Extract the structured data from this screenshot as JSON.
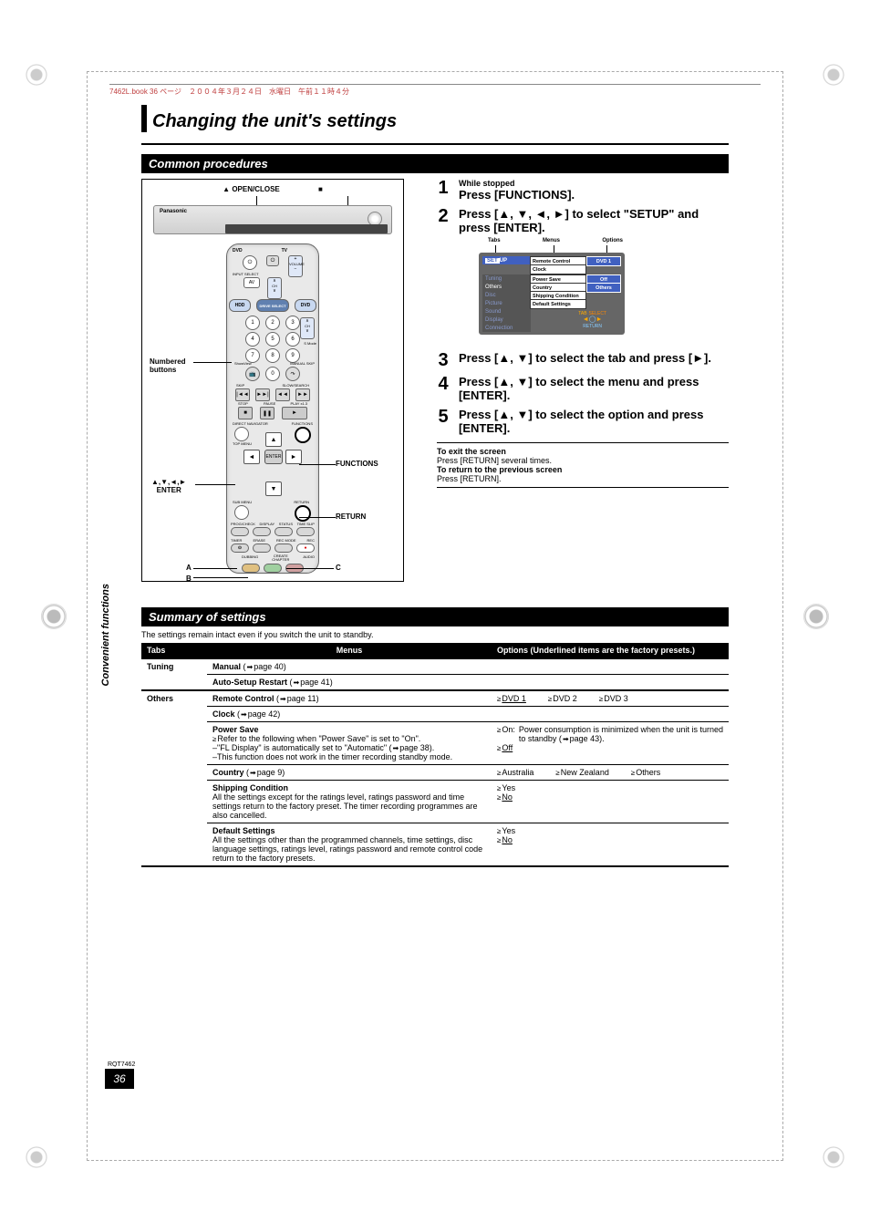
{
  "header_strip": "7462L.book  36 ページ　２００４年３月２４日　水曜日　午前１１時４分",
  "page_title": "Changing the unit's settings",
  "sections": {
    "common": "Common procedures",
    "summary": "Summary of settings"
  },
  "sidebar": "Convenient functions",
  "remote": {
    "open_close": "OPEN/CLOSE",
    "brand": "Panasonic",
    "numbered_label": "Numbered\nbuttons",
    "enter_label": "▲,▼,◄,►\nENTER",
    "functions_label": "FUNCTIONS",
    "return_label": "RETURN",
    "hdd": "HDD",
    "drive_select": "DRIVE SELECT",
    "dvd": "DVD",
    "tvlabel": "TV",
    "dvdlabel": "DVD",
    "inputsel": "INPUT SELECT",
    "av": "AV",
    "chplus": "+",
    "chminus": "−",
    "ch": "CH",
    "volplus": "+",
    "volminus": "−",
    "volume": "VOLUME",
    "nums": [
      "1",
      "2",
      "3",
      "4",
      "5",
      "6",
      "7",
      "8",
      "9",
      "0"
    ],
    "schmode": "S Mode",
    "cancel": "CANCEL",
    "manual_skip": "MANUAL SKIP",
    "showview": "ShowView",
    "skip": "SKIP",
    "slow": "SLOW/SEARCH",
    "stop": "STOP",
    "pause": "PAUSE",
    "play": "PLAY x1.3",
    "direct_nav": "DIRECT NAVIGATOR",
    "top_menu": "TOP MENU",
    "functions_btn": "FUNCTIONS",
    "enter": "ENTER",
    "submenu": "SUB MENU",
    "return_btn": "RETURN",
    "progcheck": "PROG/CHECK",
    "display": "DISPLAY",
    "status": "STATUS",
    "timeslip": "TIME SLIP",
    "timer": "TIMER",
    "erase": "ERASE",
    "recmode": "REC MODE",
    "rec": "REC",
    "dubbing": "DUBBING",
    "create_chapter": "CREATE\nCHAPTER",
    "audio": "AUDIO",
    "a_label": "A",
    "b_label": "B",
    "c_label": "C",
    "square_sym": "■",
    "triangle_sym": "▲"
  },
  "steps": {
    "s1_small": "While stopped",
    "s1_main": "Press [FUNCTIONS].",
    "s2_main": "Press [▲, ▼, ◄, ►] to select \"SETUP\" and press [ENTER].",
    "s3_main": "Press [▲, ▼] to select the tab and press [►].",
    "s4_main": "Press [▲, ▼] to select the menu and press [ENTER].",
    "s5_main": "Press [▲, ▼] to select the option and press [ENTER].",
    "n1": "1",
    "n2": "2",
    "n3": "3",
    "n4": "4",
    "n5": "5"
  },
  "setup_diagram": {
    "col_tabs": "Tabs",
    "col_menus": "Menus",
    "col_options": "Options",
    "tab_setup": "SETUP",
    "tab_tuning": "Tuning",
    "tab_others": "Others",
    "tab_disc": "Disc",
    "tab_picture": "Picture",
    "tab_sound": "Sound",
    "tab_display": "Display",
    "tab_connection": "Connection",
    "menus": [
      "Remote Control",
      "Clock",
      "Power Save",
      "Country",
      "Shipping Condition",
      "Default Settings"
    ],
    "opts": [
      "DVD 1",
      "Off",
      "Others"
    ],
    "cross_select": "SELECT",
    "cross_return": "RETURN",
    "cross_tab": "TAB"
  },
  "exit": {
    "exit_title": "To exit the screen",
    "exit_body": "Press [RETURN] several times.",
    "prev_title": "To return to the previous screen",
    "prev_body": "Press [RETURN]."
  },
  "summary": {
    "intro": "The settings remain intact even if you switch the unit to standby.",
    "hdr_tabs": "Tabs",
    "hdr_menus": "Menus",
    "hdr_options": "Options (Underlined items are the factory presets.)",
    "tuning": {
      "label": "Tuning",
      "manual": "Manual",
      "manual_ref": "page 40)",
      "auto": "Auto-Setup Restart",
      "auto_ref": "page 41)"
    },
    "others": {
      "label": "Others",
      "remote": "Remote Control",
      "remote_ref": "page 11)",
      "remote_opts": [
        "DVD 1",
        "DVD 2",
        "DVD 3"
      ],
      "clock": "Clock",
      "clock_ref": "page 42)",
      "powersave": "Power Save",
      "powersave_note1": "Refer to the following when \"Power Save\" is set to \"On\".",
      "powersave_note2": "–\"FL Display\" is automatically set to \"Automatic\" (",
      "powersave_note2b": "page 38).",
      "powersave_note3": "–This function does not work in the timer recording standby mode.",
      "powersave_on": "On:",
      "powersave_on_desc": "Power consumption is minimized when the unit is turned to standby (",
      "powersave_on_ref": "page 43).",
      "powersave_off": "Off",
      "country": "Country",
      "country_ref": "page 9)",
      "country_opts": [
        "Australia",
        "New Zealand",
        "Others"
      ],
      "shipping": "Shipping Condition",
      "shipping_desc": "All the settings except for the ratings level, ratings password and time settings return to the factory preset. The timer recording programmes are also cancelled.",
      "shipping_opts": [
        "Yes",
        "No"
      ],
      "default": "Default Settings",
      "default_desc": "All the settings other than the programmed channels, time settings, disc language settings, ratings level, ratings password and remote control code return to the factory presets.",
      "default_opts": [
        "Yes",
        "No"
      ]
    }
  },
  "footer": {
    "code": "RQT7462",
    "page": "36"
  }
}
